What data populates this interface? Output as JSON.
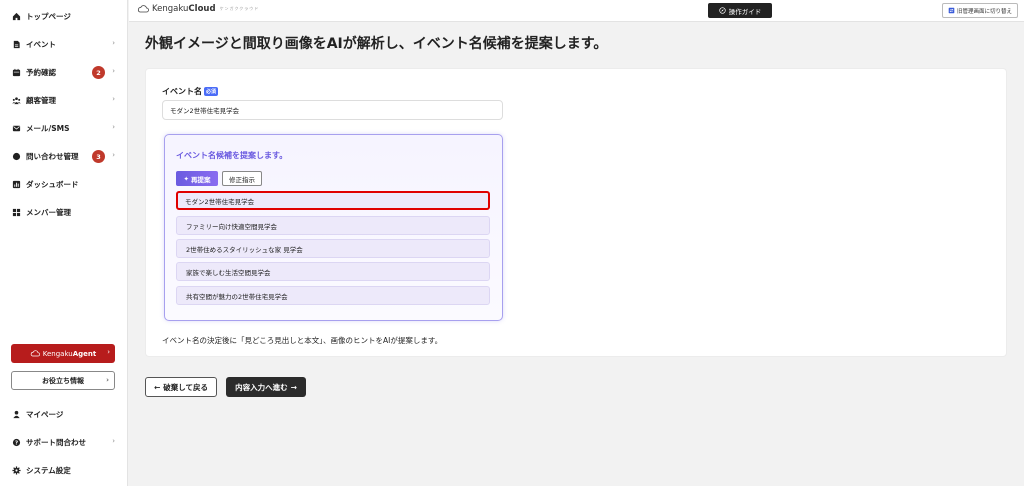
{
  "sidebar": {
    "nav": [
      {
        "icon": "home-icon",
        "label": "トップページ"
      },
      {
        "icon": "document-icon",
        "label": "イベント",
        "chevron": true
      },
      {
        "icon": "calendar-icon",
        "label": "予約確認",
        "chevron": true,
        "badge": "2"
      },
      {
        "icon": "users-icon",
        "label": "顧客管理",
        "chevron": true
      },
      {
        "icon": "mail-icon",
        "label": "メール/SMS",
        "chevron": true
      },
      {
        "icon": "chat-icon",
        "label": "問い合わせ管理",
        "chevron": true,
        "badge": "3"
      },
      {
        "icon": "dashboard-icon",
        "label": "ダッシュボード"
      },
      {
        "icon": "grid-icon",
        "label": "メンバー管理"
      }
    ],
    "agent_label_prefix": "Kengaku",
    "agent_label_bold": "Agent",
    "info_label": "お役立ち情報",
    "bottom": [
      {
        "icon": "user-icon",
        "label": "マイページ"
      },
      {
        "icon": "help-icon",
        "label": "サポート問合わせ",
        "chevron": true
      },
      {
        "icon": "gear-icon",
        "label": "システム設定"
      }
    ]
  },
  "topbar": {
    "logo_prefix": "Kengaku",
    "logo_bold": "Cloud",
    "tagline": "ケンガククラウド",
    "guide_label": "操作ガイド",
    "switch_label": "旧管理画面に切り替え"
  },
  "main": {
    "title": "外観イメージと間取り画像をAIが解析し、イベント名候補を提案します。",
    "field_label": "イベント名",
    "required_label": "必須",
    "input_value": "モダン2世帯住宅見学会",
    "suggest_title": "イベント名候補を提案します。",
    "regen_label": "再提案",
    "fix_label": "修正指示",
    "options": [
      "モダン2世帯住宅見学会",
      "ファミリー向け快適空間見学会",
      "2世帯住めるスタイリッシュな家 見学会",
      "家族で楽しむ生活空間見学会",
      "共有空間が魅力の2世帯住宅見学会"
    ],
    "selected_index": 0,
    "hint": "イベント名の決定後に「見どころ見出しと本文」、画像のヒントをAIが提案します。",
    "back_label": "破棄して戻る",
    "next_label": "内容入力へ進む"
  },
  "colors": {
    "accent": "#6a5ae0",
    "selection_border": "#e00000",
    "badge": "#c0392b",
    "agent": "#b71c1c"
  }
}
